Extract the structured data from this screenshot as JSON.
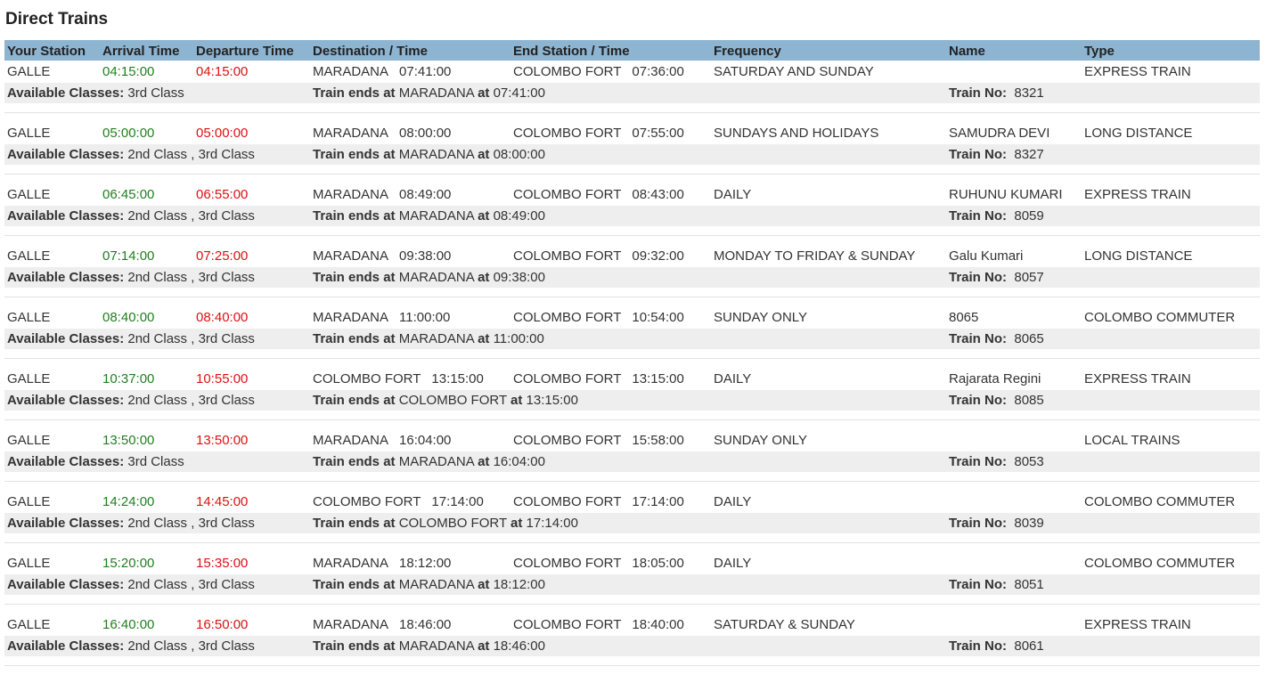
{
  "page_title": "Direct Trains",
  "headers": {
    "your_station": "Your Station",
    "arrival_time": "Arrival Time",
    "departure_time": "Departure Time",
    "destination_time": "Destination / Time",
    "end_station_time": "End Station / Time",
    "frequency": "Frequency",
    "name": "Name",
    "type": "Type"
  },
  "labels": {
    "available_classes": "Available Classes:",
    "train_ends_at": "Train ends at",
    "at": "at",
    "train_no": "Train No:"
  },
  "colors": {
    "header_bg": "#8db4d1",
    "arrival": "#1f7f1f",
    "departure": "#e01010",
    "detail_row_bg": "#eeeeee"
  },
  "trains": [
    {
      "station": "GALLE",
      "arrival": "04:15:00",
      "departure": "04:15:00",
      "dest": "MARADANA",
      "dest_time": "07:41:00",
      "end_station": "COLOMBO FORT",
      "end_time": "07:36:00",
      "frequency": "SATURDAY AND SUNDAY",
      "name": "",
      "type": "EXPRESS TRAIN",
      "classes": "3rd Class",
      "ends_at": "MARADANA",
      "ends_time": "07:41:00",
      "train_no": "8321"
    },
    {
      "station": "GALLE",
      "arrival": "05:00:00",
      "departure": "05:00:00",
      "dest": "MARADANA",
      "dest_time": "08:00:00",
      "end_station": "COLOMBO FORT",
      "end_time": "07:55:00",
      "frequency": "SUNDAYS AND HOLIDAYS",
      "name": "SAMUDRA DEVI",
      "type": "LONG DISTANCE",
      "classes": "2nd Class ,  3rd Class",
      "ends_at": "MARADANA",
      "ends_time": "08:00:00",
      "train_no": "8327"
    },
    {
      "station": "GALLE",
      "arrival": "06:45:00",
      "departure": "06:55:00",
      "dest": "MARADANA",
      "dest_time": "08:49:00",
      "end_station": "COLOMBO FORT",
      "end_time": "08:43:00",
      "frequency": "DAILY",
      "name": "RUHUNU KUMARI",
      "type": "EXPRESS TRAIN",
      "classes": "2nd Class ,  3rd Class",
      "ends_at": "MARADANA",
      "ends_time": "08:49:00",
      "train_no": "8059"
    },
    {
      "station": "GALLE",
      "arrival": "07:14:00",
      "departure": "07:25:00",
      "dest": "MARADANA",
      "dest_time": "09:38:00",
      "end_station": "COLOMBO FORT",
      "end_time": "09:32:00",
      "frequency": "MONDAY TO FRIDAY & SUNDAY",
      "name": "Galu Kumari",
      "type": "LONG DISTANCE",
      "classes": "2nd Class ,  3rd Class",
      "ends_at": "MARADANA",
      "ends_time": "09:38:00",
      "train_no": "8057"
    },
    {
      "station": "GALLE",
      "arrival": "08:40:00",
      "departure": "08:40:00",
      "dest": "MARADANA",
      "dest_time": "11:00:00",
      "end_station": "COLOMBO FORT",
      "end_time": "10:54:00",
      "frequency": "SUNDAY ONLY",
      "name": "8065",
      "type": "COLOMBO COMMUTER",
      "classes": "2nd Class ,  3rd Class",
      "ends_at": "MARADANA",
      "ends_time": "11:00:00",
      "train_no": "8065"
    },
    {
      "station": "GALLE",
      "arrival": "10:37:00",
      "departure": "10:55:00",
      "dest": "COLOMBO FORT",
      "dest_time": "13:15:00",
      "end_station": "COLOMBO FORT",
      "end_time": "13:15:00",
      "frequency": "DAILY",
      "name": "Rajarata Regini",
      "type": "EXPRESS TRAIN",
      "classes": "2nd Class ,  3rd Class",
      "ends_at": "COLOMBO FORT",
      "ends_time": "13:15:00",
      "train_no": "8085"
    },
    {
      "station": "GALLE",
      "arrival": "13:50:00",
      "departure": "13:50:00",
      "dest": "MARADANA",
      "dest_time": "16:04:00",
      "end_station": "COLOMBO FORT",
      "end_time": "15:58:00",
      "frequency": "SUNDAY ONLY",
      "name": "",
      "type": "LOCAL TRAINS",
      "classes": "3rd Class",
      "ends_at": "MARADANA",
      "ends_time": "16:04:00",
      "train_no": "8053"
    },
    {
      "station": "GALLE",
      "arrival": "14:24:00",
      "departure": "14:45:00",
      "dest": "COLOMBO FORT",
      "dest_time": "17:14:00",
      "end_station": "COLOMBO FORT",
      "end_time": "17:14:00",
      "frequency": "DAILY",
      "name": "",
      "type": "COLOMBO COMMUTER",
      "classes": "2nd Class ,  3rd Class",
      "ends_at": "COLOMBO FORT",
      "ends_time": "17:14:00",
      "train_no": "8039"
    },
    {
      "station": "GALLE",
      "arrival": "15:20:00",
      "departure": "15:35:00",
      "dest": "MARADANA",
      "dest_time": "18:12:00",
      "end_station": "COLOMBO FORT",
      "end_time": "18:05:00",
      "frequency": "DAILY",
      "name": "",
      "type": "COLOMBO COMMUTER",
      "classes": "2nd Class ,  3rd Class",
      "ends_at": "MARADANA",
      "ends_time": "18:12:00",
      "train_no": "8051"
    },
    {
      "station": "GALLE",
      "arrival": "16:40:00",
      "departure": "16:50:00",
      "dest": "MARADANA",
      "dest_time": "18:46:00",
      "end_station": "COLOMBO FORT",
      "end_time": "18:40:00",
      "frequency": "SATURDAY & SUNDAY",
      "name": "",
      "type": "EXPRESS TRAIN",
      "classes": "2nd Class ,  3rd Class",
      "ends_at": "MARADANA",
      "ends_time": "18:46:00",
      "train_no": "8061"
    }
  ]
}
